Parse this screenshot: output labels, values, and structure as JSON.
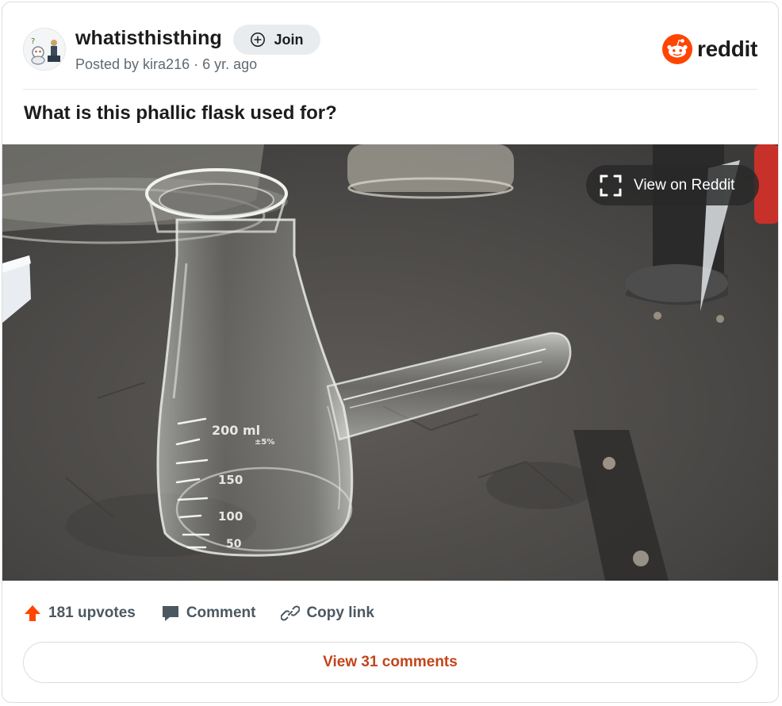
{
  "header": {
    "subreddit": "whatisthisthing",
    "join_label": "Join",
    "posted": "Posted by kira216 · 6 yr. ago",
    "brand": "reddit"
  },
  "post": {
    "title": "What is this phallic flask used for?",
    "view_label": "View on Reddit",
    "flask_markings": [
      "200 ml",
      "±5%",
      "150",
      "100",
      "50"
    ]
  },
  "actions": {
    "upvotes": "181 upvotes",
    "comment": "Comment",
    "copy_link": "Copy link"
  },
  "footer": {
    "view_comments": "View 31 comments"
  },
  "colors": {
    "brand": "#ff4500",
    "upvote": "#ff4500",
    "comments_text": "#c4441a"
  }
}
